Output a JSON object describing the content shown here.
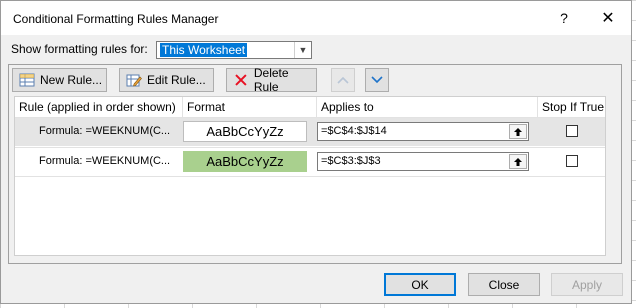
{
  "dialog": {
    "title": "Conditional Formatting Rules Manager",
    "help_glyph": "?",
    "close_glyph": "✕"
  },
  "show_rules": {
    "label": "Show formatting rules for:",
    "selected": "This Worksheet"
  },
  "toolbar": {
    "new_rule": "New Rule...",
    "edit_rule": "Edit Rule...",
    "delete_rule": "Delete Rule"
  },
  "table": {
    "headers": {
      "rule": "Rule (applied in order shown)",
      "format": "Format",
      "applies_to": "Applies to",
      "stop_if_true": "Stop If True"
    },
    "rows": [
      {
        "rule": "Formula: =WEEKNUM(C...",
        "preview_text": "AaBbCcYyZz",
        "preview_fill": "#ffffff",
        "applies_to": "=$C$4:$J$14",
        "stop_if_true": false
      },
      {
        "rule": "Formula: =WEEKNUM(C...",
        "preview_text": "AaBbCcYyZz",
        "preview_fill": "#a9d08e",
        "applies_to": "=$C$3:$J$3",
        "stop_if_true": false
      }
    ]
  },
  "footer": {
    "ok": "OK",
    "close": "Close",
    "apply": "Apply"
  },
  "colors": {
    "selection_blue": "#0078d7",
    "green_preview": "#a9d08e",
    "delete_red": "#e81123"
  }
}
